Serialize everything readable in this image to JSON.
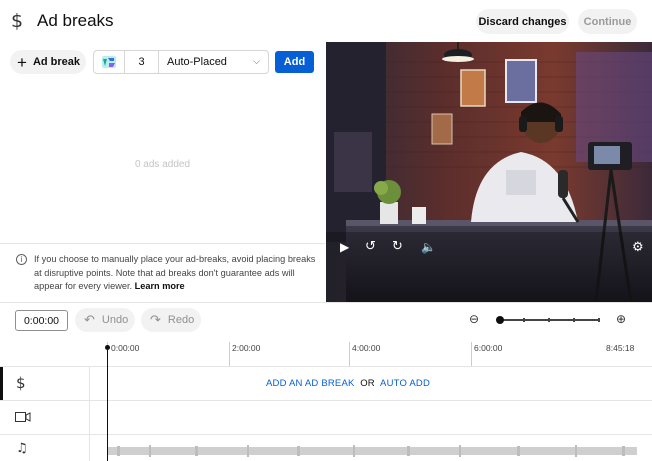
{
  "header": {
    "title": "Ad breaks",
    "discard_label": "Discard changes",
    "continue_label": "Continue"
  },
  "toolbar": {
    "ad_break_label": "Ad break",
    "count_value": "3",
    "placement_value": "Auto-Placed",
    "add_label": "Add"
  },
  "empty_state": "0 ads added",
  "info": {
    "text": "If you choose to manually place your ad-breaks, avoid placing breaks at disruptive points. Note that ad breaks don't guarantee ads will appear for every viewer.",
    "learn_more": "Learn more"
  },
  "timeline": {
    "current_time": "0:00:00",
    "undo_label": "Undo",
    "redo_label": "Redo",
    "ticks": [
      "0:00:00",
      "2:00:00",
      "4:00:00",
      "6:00:00",
      "8:45:18"
    ],
    "add_ad_break_link": "ADD AN AD BREAK",
    "or_text": "OR",
    "auto_add_link": "AUTO ADD"
  },
  "colors": {
    "accent": "#065fd4",
    "pill_bg": "#f2f2f2",
    "border": "#e5e5e5"
  }
}
